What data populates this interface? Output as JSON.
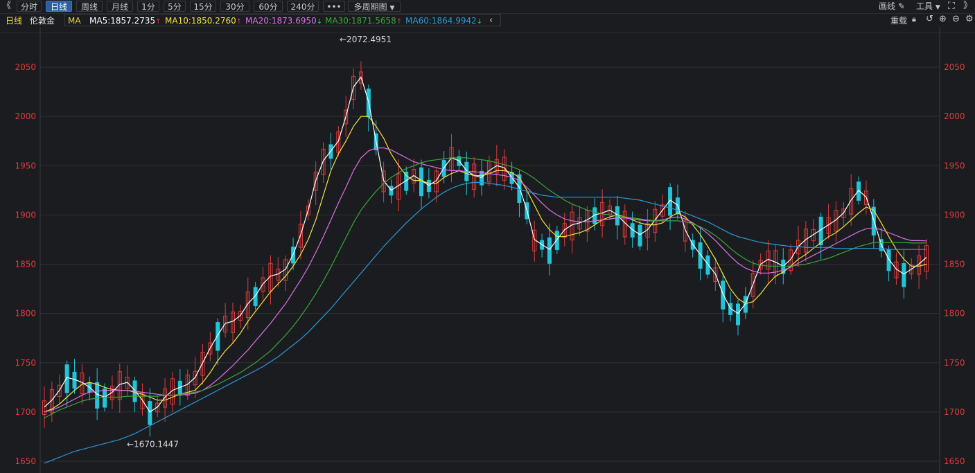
{
  "toolbar": {
    "tabs": [
      "分时",
      "日线",
      "周线",
      "月线",
      "1分",
      "5分",
      "15分",
      "30分",
      "60分",
      "240分"
    ],
    "more_label": "•••",
    "multi_period_label": "多周期图",
    "draw_label": "画线",
    "tools_label": "工具"
  },
  "info_bar": {
    "period": "日线",
    "symbol": "伦敦金",
    "ma_label": "MA",
    "ma5": "MA5:1857.2735",
    "ma10": "MA10:1850.2760",
    "ma20": "MA20:1873.6950",
    "ma30": "MA30:1871.5658",
    "ma60": "MA60:1864.9942",
    "reload_label": "重载"
  },
  "colors": {
    "bg": "#1b1c20",
    "up": "#e03c3c",
    "down": "#22c4d8",
    "ma5": "#ffffff",
    "ma10": "#f5e342",
    "ma20": "#e070e8",
    "ma30": "#3aa83a",
    "ma60": "#2a9ad8",
    "axis_text": "#e03c3c"
  },
  "chart_data": {
    "type": "candlestick",
    "y_ticks": [
      1650,
      1700,
      1750,
      1800,
      1850,
      1900,
      1950,
      2000,
      2050
    ],
    "ylim": [
      1645,
      2080
    ],
    "annotations": [
      {
        "label": "←2072.4951",
        "value": 2072.4951
      },
      {
        "label": "←1670.1447",
        "value": 1670.1447
      }
    ],
    "ma_series": [
      {
        "name": "MA5",
        "values": [
          1705,
          1712,
          1722,
          1735,
          1733,
          1730,
          1725,
          1718,
          1715,
          1720,
          1728,
          1730,
          1722,
          1712,
          1700,
          1705,
          1715,
          1722,
          1725,
          1728,
          1735,
          1750,
          1765,
          1778,
          1790,
          1792,
          1798,
          1810,
          1818,
          1830,
          1838,
          1840,
          1845,
          1860,
          1880,
          1905,
          1935,
          1955,
          1965,
          1975,
          2000,
          2030,
          2040,
          2015,
          1975,
          1935,
          1925,
          1930,
          1935,
          1940,
          1935,
          1930,
          1935,
          1948,
          1958,
          1955,
          1945,
          1940,
          1938,
          1945,
          1950,
          1948,
          1938,
          1928,
          1905,
          1875,
          1870,
          1865,
          1875,
          1885,
          1890,
          1892,
          1895,
          1900,
          1902,
          1905,
          1900,
          1892,
          1885,
          1880,
          1885,
          1895,
          1905,
          1915,
          1910,
          1885,
          1870,
          1860,
          1850,
          1840,
          1820,
          1805,
          1800,
          1810,
          1830,
          1850,
          1855,
          1852,
          1848,
          1855,
          1868,
          1875,
          1880,
          1885,
          1890,
          1895,
          1902,
          1915,
          1925,
          1918,
          1895,
          1870,
          1855,
          1845,
          1840,
          1845,
          1850,
          1857
        ]
      },
      {
        "name": "MA10",
        "values": [
          1700,
          1703,
          1708,
          1715,
          1722,
          1728,
          1730,
          1728,
          1725,
          1723,
          1722,
          1722,
          1720,
          1718,
          1715,
          1712,
          1712,
          1715,
          1718,
          1720,
          1722,
          1730,
          1740,
          1752,
          1762,
          1770,
          1780,
          1792,
          1802,
          1812,
          1822,
          1830,
          1838,
          1848,
          1860,
          1875,
          1895,
          1920,
          1945,
          1962,
          1975,
          1990,
          2000,
          2000,
          1990,
          1978,
          1962,
          1950,
          1940,
          1935,
          1935,
          1932,
          1932,
          1938,
          1942,
          1945,
          1942,
          1940,
          1940,
          1942,
          1945,
          1945,
          1943,
          1938,
          1925,
          1910,
          1895,
          1885,
          1878,
          1878,
          1880,
          1882,
          1885,
          1890,
          1895,
          1898,
          1900,
          1898,
          1895,
          1892,
          1890,
          1890,
          1892,
          1898,
          1902,
          1898,
          1890,
          1880,
          1868,
          1855,
          1840,
          1825,
          1815,
          1810,
          1812,
          1820,
          1830,
          1838,
          1842,
          1848,
          1855,
          1860,
          1866,
          1872,
          1878,
          1882,
          1888,
          1895,
          1902,
          1908,
          1905,
          1892,
          1878,
          1865,
          1855,
          1848,
          1848,
          1850
        ]
      },
      {
        "name": "MA20",
        "values": [
          1700,
          1702,
          1705,
          1709,
          1713,
          1717,
          1720,
          1721,
          1722,
          1722,
          1722,
          1722,
          1721,
          1720,
          1719,
          1718,
          1717,
          1717,
          1717,
          1718,
          1719,
          1722,
          1727,
          1733,
          1740,
          1747,
          1755,
          1763,
          1772,
          1781,
          1790,
          1800,
          1810,
          1822,
          1834,
          1847,
          1862,
          1878,
          1895,
          1912,
          1928,
          1945,
          1958,
          1965,
          1968,
          1968,
          1966,
          1962,
          1958,
          1954,
          1952,
          1950,
          1948,
          1946,
          1945,
          1945,
          1944,
          1944,
          1943,
          1942,
          1941,
          1940,
          1938,
          1935,
          1928,
          1920,
          1912,
          1905,
          1900,
          1896,
          1894,
          1893,
          1893,
          1894,
          1895,
          1896,
          1897,
          1897,
          1896,
          1895,
          1894,
          1894,
          1895,
          1897,
          1898,
          1896,
          1892,
          1887,
          1881,
          1874,
          1866,
          1858,
          1851,
          1846,
          1843,
          1841,
          1841,
          1842,
          1844,
          1847,
          1851,
          1855,
          1859,
          1863,
          1867,
          1871,
          1875,
          1879,
          1883,
          1886,
          1887,
          1885,
          1882,
          1879,
          1876,
          1874,
          1874,
          1873.7
        ]
      },
      {
        "name": "MA30",
        "values": [
          1694,
          1698,
          1702,
          1705,
          1708,
          1711,
          1713,
          1714,
          1715,
          1715,
          1715,
          1716,
          1716,
          1716,
          1716,
          1716,
          1717,
          1717,
          1718,
          1719,
          1720,
          1722,
          1725,
          1728,
          1732,
          1736,
          1740,
          1745,
          1750,
          1756,
          1762,
          1770,
          1778,
          1787,
          1797,
          1808,
          1820,
          1833,
          1847,
          1862,
          1877,
          1892,
          1905,
          1915,
          1924,
          1932,
          1938,
          1943,
          1947,
          1950,
          1953,
          1955,
          1956,
          1957,
          1958,
          1958,
          1958,
          1957,
          1956,
          1955,
          1953,
          1951,
          1949,
          1946,
          1942,
          1937,
          1931,
          1925,
          1920,
          1915,
          1911,
          1908,
          1905,
          1903,
          1901,
          1900,
          1899,
          1898,
          1897,
          1896,
          1895,
          1894,
          1894,
          1894,
          1894,
          1893,
          1891,
          1888,
          1884,
          1879,
          1873,
          1866,
          1860,
          1855,
          1851,
          1849,
          1848,
          1848,
          1848,
          1848,
          1849,
          1850,
          1852,
          1854,
          1856,
          1859,
          1862,
          1865,
          1868,
          1870,
          1872,
          1872,
          1872,
          1872,
          1872,
          1871.5,
          1871.5,
          1871.6
        ]
      },
      {
        "name": "MA60",
        "values": [
          1648,
          1651,
          1654,
          1657,
          1660,
          1662,
          1664,
          1666,
          1668,
          1670,
          1672,
          1675,
          1678,
          1682,
          1686,
          1690,
          1694,
          1698,
          1702,
          1706,
          1710,
          1714,
          1718,
          1722,
          1726,
          1730,
          1734,
          1738,
          1742,
          1746,
          1751,
          1756,
          1762,
          1768,
          1774,
          1781,
          1789,
          1797,
          1805,
          1814,
          1823,
          1832,
          1841,
          1850,
          1859,
          1868,
          1876,
          1884,
          1892,
          1899,
          1906,
          1912,
          1918,
          1923,
          1927,
          1930,
          1932,
          1933,
          1933,
          1932,
          1931,
          1930,
          1928,
          1926,
          1924,
          1922,
          1920,
          1919,
          1918,
          1918,
          1918,
          1918,
          1918,
          1918,
          1918,
          1918,
          1918,
          1917,
          1916,
          1915,
          1913,
          1911,
          1909,
          1907,
          1905,
          1902,
          1899,
          1896,
          1893,
          1889,
          1885,
          1881,
          1878,
          1876,
          1874,
          1872,
          1871,
          1870,
          1869,
          1868,
          1868,
          1867,
          1867,
          1867,
          1867,
          1866,
          1866,
          1866,
          1866,
          1866,
          1866,
          1866,
          1865,
          1865,
          1865,
          1865,
          1865,
          1865
        ]
      }
    ]
  }
}
